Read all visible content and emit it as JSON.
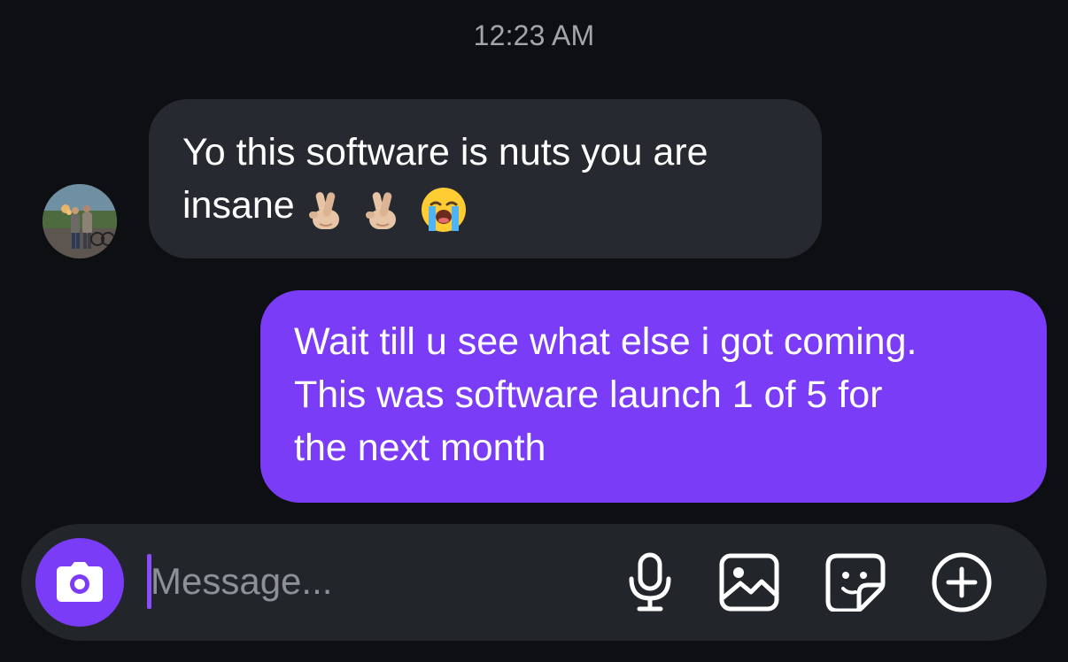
{
  "conversation": {
    "timestamp": "12:23 AM",
    "messages": [
      {
        "direction": "incoming",
        "lines": [
          "Yo this software is nuts you are",
          "insane"
        ],
        "emojis": [
          "crossed-fingers",
          "crossed-fingers",
          "loudly-crying-face"
        ]
      },
      {
        "direction": "outgoing",
        "lines": [
          "Wait till u see what else i got coming.",
          "This was software launch 1 of 5 for",
          "the next month"
        ]
      }
    ]
  },
  "composer": {
    "placeholder": "Message...",
    "value": "",
    "icons": [
      "camera-icon",
      "microphone-icon",
      "photo-icon",
      "sticker-icon",
      "plus-icon"
    ]
  },
  "colors": {
    "background": "#0d0f12",
    "incoming_bubble": "#262a30",
    "outgoing_bubble": "#7b3cf7",
    "accent": "#7b3cf7"
  }
}
